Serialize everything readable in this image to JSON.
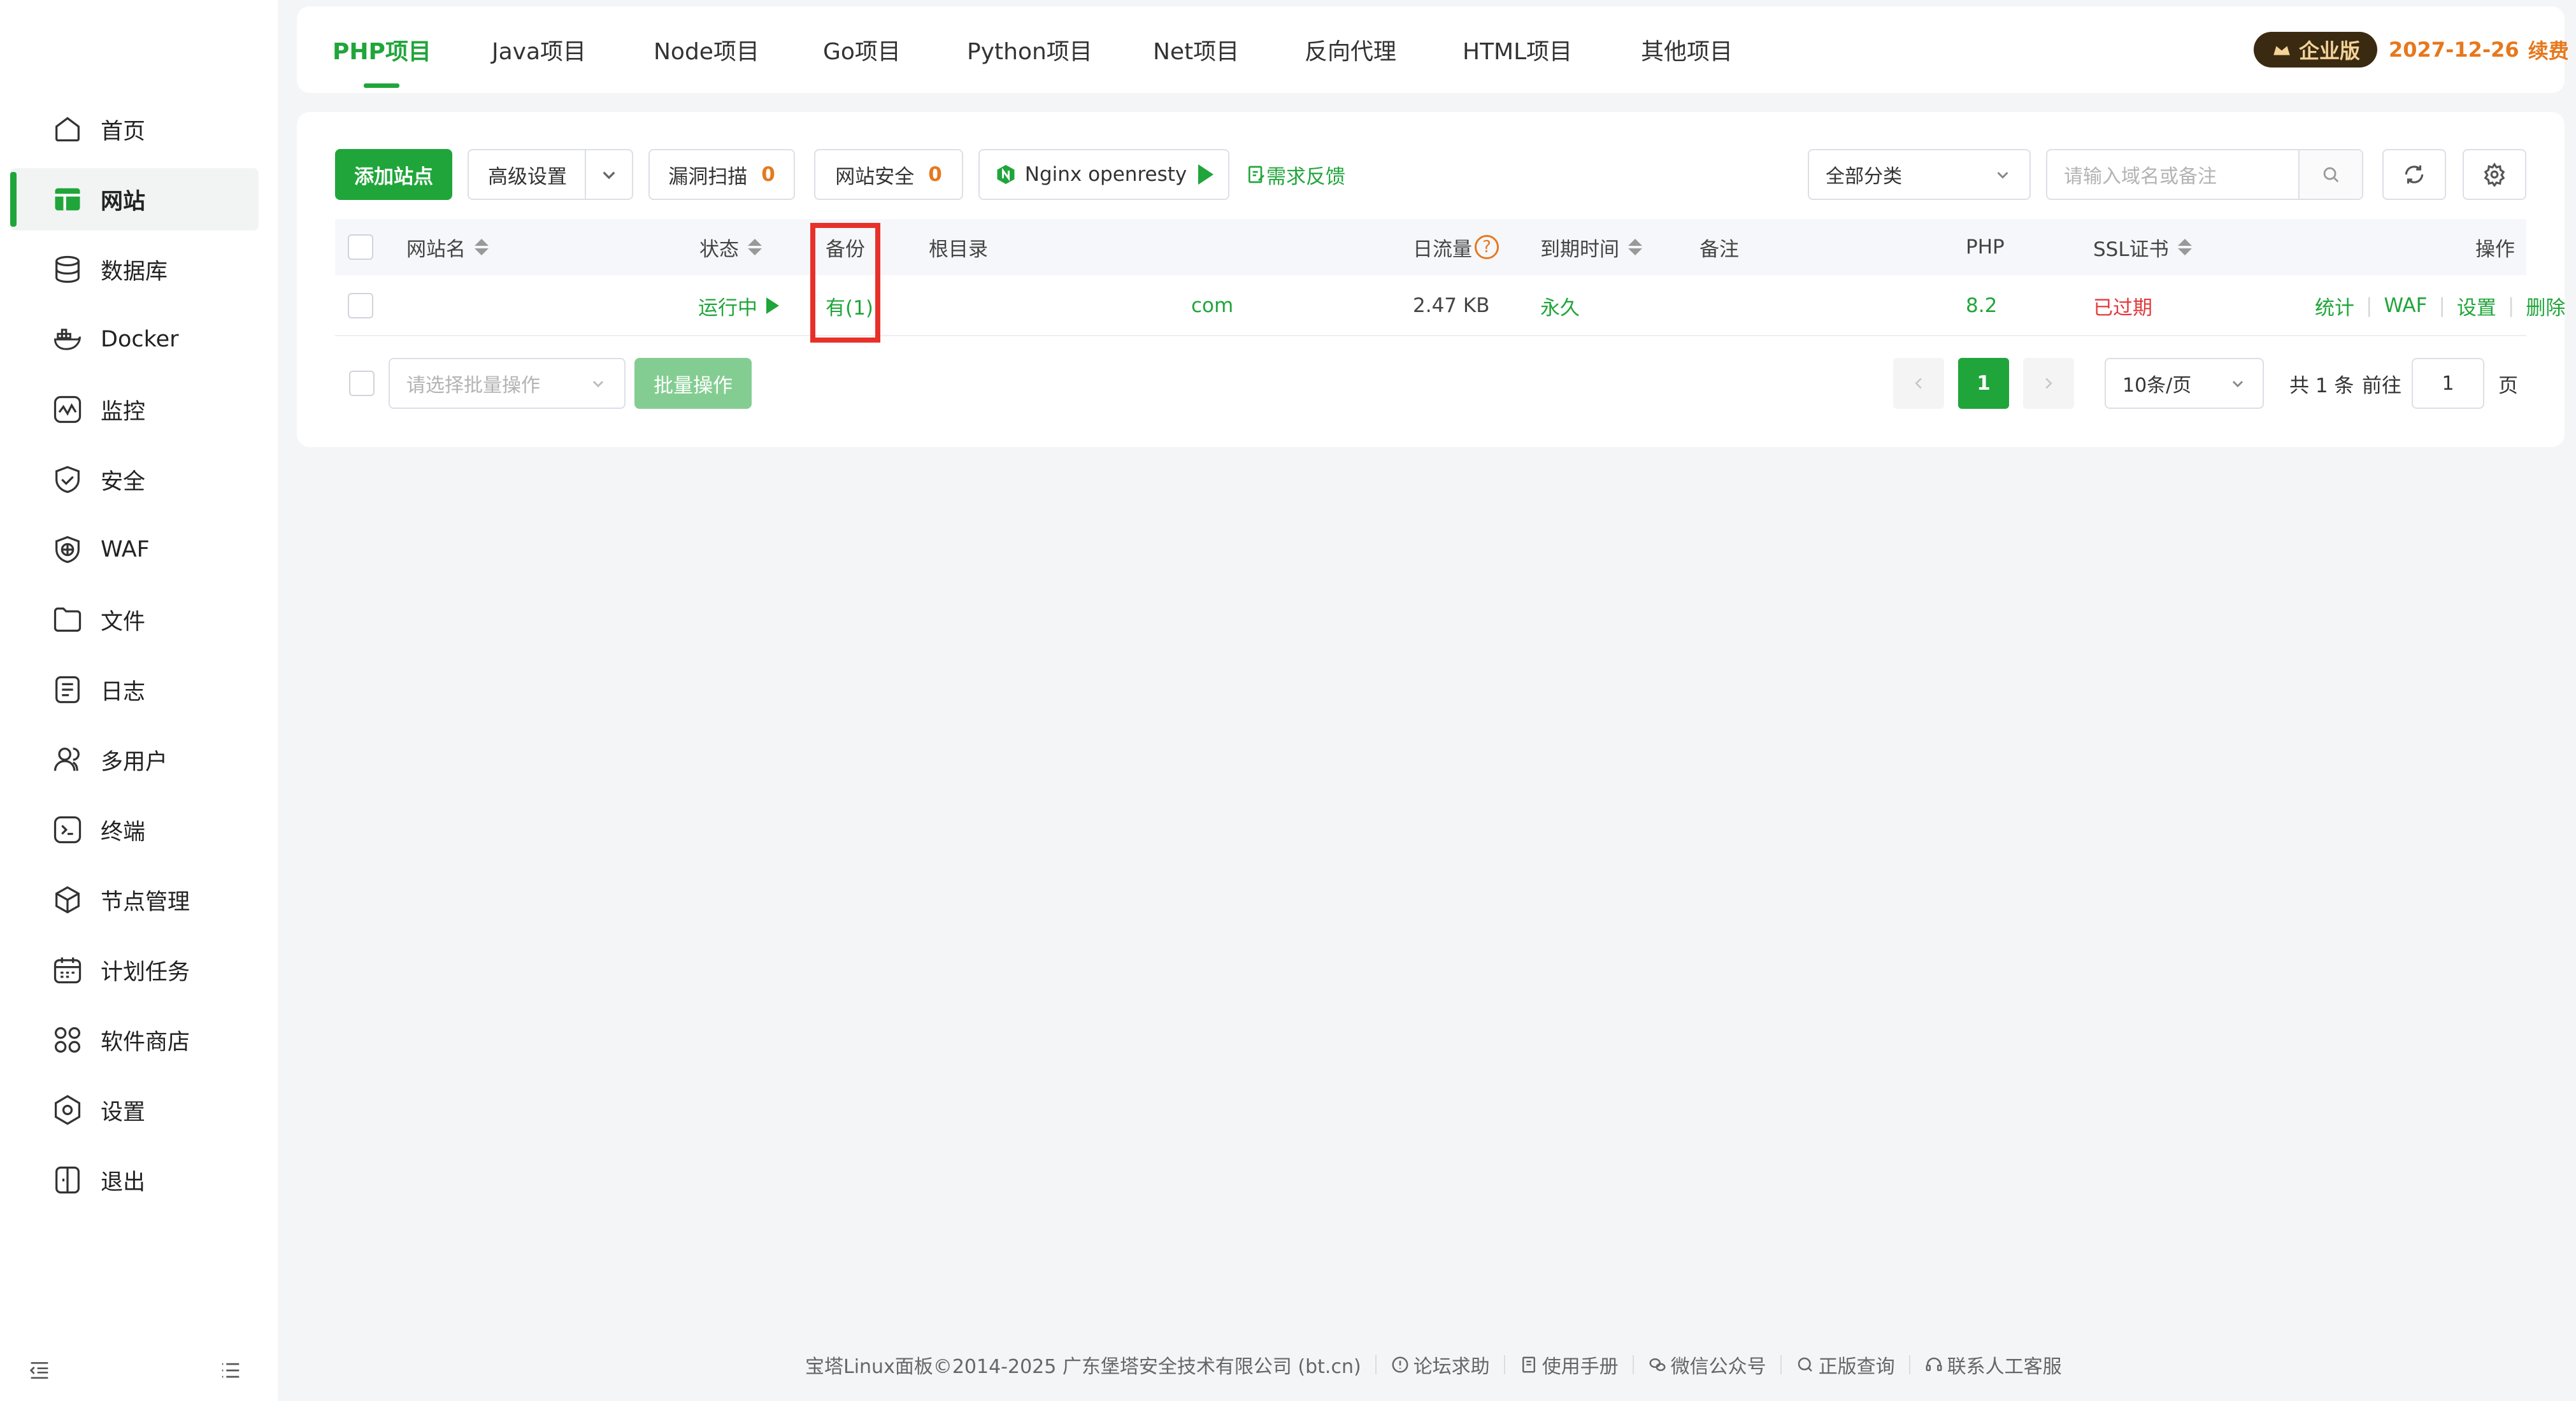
{
  "sidebar": {
    "items": [
      {
        "label": "首页",
        "icon": "home-icon"
      },
      {
        "label": "网站",
        "icon": "website-icon",
        "active": true
      },
      {
        "label": "数据库",
        "icon": "database-icon"
      },
      {
        "label": "Docker",
        "icon": "docker-icon"
      },
      {
        "label": "监控",
        "icon": "monitor-icon"
      },
      {
        "label": "安全",
        "icon": "shield-icon"
      },
      {
        "label": "WAF",
        "icon": "waf-icon"
      },
      {
        "label": "文件",
        "icon": "folder-icon"
      },
      {
        "label": "日志",
        "icon": "log-icon"
      },
      {
        "label": "多用户",
        "icon": "users-icon"
      },
      {
        "label": "终端",
        "icon": "terminal-icon"
      },
      {
        "label": "节点管理",
        "icon": "node-icon"
      },
      {
        "label": "计划任务",
        "icon": "calendar-icon"
      },
      {
        "label": "软件商店",
        "icon": "apps-icon"
      },
      {
        "label": "设置",
        "icon": "settings-icon"
      },
      {
        "label": "退出",
        "icon": "logout-icon"
      }
    ]
  },
  "tabs": [
    {
      "label": "PHP项目",
      "active": true
    },
    {
      "label": "Java项目"
    },
    {
      "label": "Node项目"
    },
    {
      "label": "Go项目"
    },
    {
      "label": "Python项目"
    },
    {
      "label": "Net项目"
    },
    {
      "label": "反向代理"
    },
    {
      "label": "HTML项目"
    },
    {
      "label": "其他项目"
    }
  ],
  "enterprise": {
    "badge": "企业版",
    "date": "2027-12-26",
    "renew": "续费"
  },
  "toolbar": {
    "add_site": "添加站点",
    "advanced": "高级设置",
    "vuln_scan": "漏洞扫描",
    "vuln_count": "0",
    "site_security": "网站安全",
    "security_count": "0",
    "nginx": "Nginx openresty",
    "feedback": "需求反馈",
    "category": "全部分类",
    "search_placeholder": "请输入域名或备注"
  },
  "table": {
    "headers": {
      "name": "网站名",
      "status": "状态",
      "backup": "备份",
      "root": "根目录",
      "traffic": "日流量",
      "expire": "到期时间",
      "note": "备注",
      "php": "PHP",
      "ssl": "SSL证书",
      "ops": "操作"
    },
    "rows": [
      {
        "name": "",
        "status": "运行中",
        "backup": "有(1)",
        "root": "com",
        "traffic": "2.47 KB",
        "expire": "永久",
        "note": "",
        "php": "8.2",
        "ssl": "已过期",
        "ops": [
          "统计",
          "WAF",
          "设置",
          "删除"
        ]
      }
    ]
  },
  "batch": {
    "placeholder": "请选择批量操作",
    "button": "批量操作"
  },
  "pagination": {
    "current": "1",
    "page_size": "10条/页",
    "total": "共 1 条",
    "goto": "前往",
    "goto_value": "1",
    "page_unit": "页"
  },
  "footer": {
    "copyright": "宝塔Linux面板©2014-2025 广东堡塔安全技术有限公司 (bt.cn)",
    "links": [
      "论坛求助",
      "使用手册",
      "微信公众号",
      "正版查询",
      "联系人工客服"
    ]
  },
  "colors": {
    "accent": "#20a53a",
    "warning": "#e6781d",
    "danger": "#e4393c",
    "highlight": "#e8302a"
  }
}
